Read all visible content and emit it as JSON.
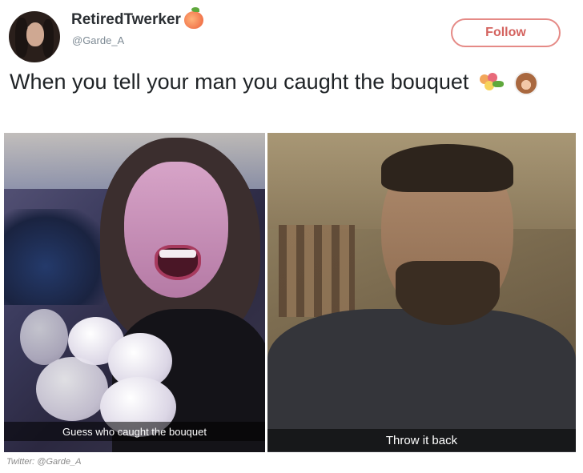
{
  "user": {
    "display_name": "RetiredTwerker",
    "handle": "@Garde_A",
    "name_emoji": "peach-icon"
  },
  "follow_button": {
    "label": "Follow"
  },
  "tweet": {
    "text": "When you tell your man you caught the bouquet",
    "emojis": [
      "bouquet-icon",
      "bride-icon"
    ]
  },
  "photos": {
    "left_caption": "Guess who caught the bouquet",
    "right_caption": "Throw it back"
  },
  "credit": "Twitter: @Garde_A",
  "colors": {
    "follow_accent": "#d4635f",
    "text": "#1f2326",
    "handle": "#7d8a94"
  }
}
